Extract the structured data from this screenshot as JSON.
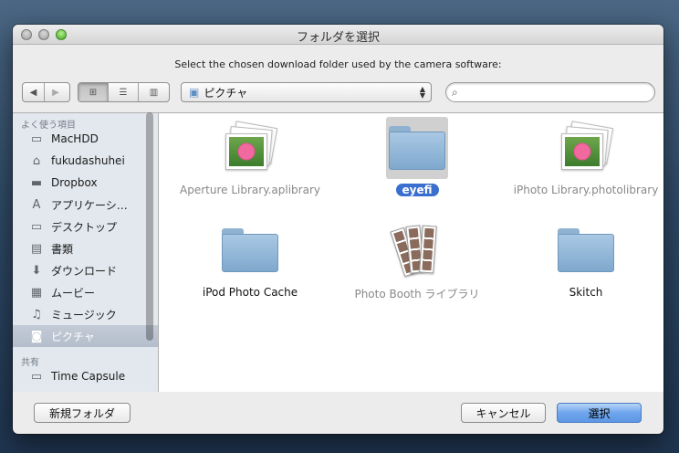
{
  "window": {
    "title": "フォルダを選択"
  },
  "prompt": "Select the chosen download folder used by the camera software:",
  "toolbar": {
    "location": "ピクチャ",
    "search_placeholder": ""
  },
  "sidebar": {
    "sections": [
      {
        "header": "よく使う項目",
        "items": [
          {
            "label": "MacHDD",
            "icon": "hard-drive-icon",
            "glyph": "▭"
          },
          {
            "label": "fukudashuhei",
            "icon": "home-icon",
            "glyph": "⌂"
          },
          {
            "label": "Dropbox",
            "icon": "folder-icon",
            "glyph": "▬"
          },
          {
            "label": "アプリケーシ…",
            "icon": "applications-icon",
            "glyph": "A"
          },
          {
            "label": "デスクトップ",
            "icon": "desktop-icon",
            "glyph": "▭"
          },
          {
            "label": "書類",
            "icon": "documents-icon",
            "glyph": "▤"
          },
          {
            "label": "ダウンロード",
            "icon": "download-icon",
            "glyph": "⬇"
          },
          {
            "label": "ムービー",
            "icon": "movies-icon",
            "glyph": "▦"
          },
          {
            "label": "ミュージック",
            "icon": "music-icon",
            "glyph": "♫"
          },
          {
            "label": "ピクチャ",
            "icon": "camera-icon",
            "glyph": "◙",
            "selected": true
          }
        ]
      },
      {
        "header": "共有",
        "items": [
          {
            "label": "Time Capsule",
            "icon": "time-capsule-icon",
            "glyph": "▭"
          }
        ]
      }
    ]
  },
  "files": [
    {
      "name": "Aperture Library.aplibrary",
      "kind": "photo-library",
      "dim": true
    },
    {
      "name": "eyefi",
      "kind": "folder",
      "selected": true
    },
    {
      "name": "iPhoto Library.photolibrary",
      "kind": "photo-library",
      "dim": true
    },
    {
      "name": "iPod Photo Cache",
      "kind": "folder"
    },
    {
      "name": "Photo Booth ライブラリ",
      "kind": "photo-booth",
      "dim": true
    },
    {
      "name": "Skitch",
      "kind": "folder"
    }
  ],
  "footer": {
    "new_folder": "新規フォルダ",
    "cancel": "キャンセル",
    "choose": "選択"
  }
}
